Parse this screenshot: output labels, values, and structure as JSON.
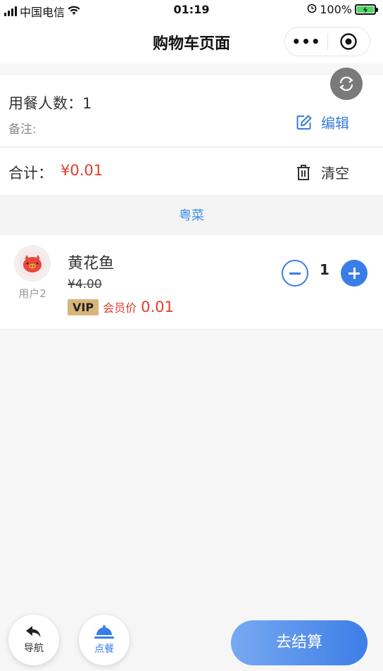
{
  "status_bar": {
    "carrier": "中国电信",
    "time": "01:19",
    "battery": "100%"
  },
  "navbar": {
    "title": "购物车页面",
    "more_label": "•••"
  },
  "order_info": {
    "diners_label": "用餐人数：",
    "diners_count": "1",
    "remark_label": "备注:",
    "edit_label": "编辑"
  },
  "summary": {
    "total_label": "合计：",
    "total_value": "¥0.01",
    "clear_label": "清空"
  },
  "category": {
    "name": "粤菜"
  },
  "cart_items": [
    {
      "user": "用户2",
      "name": "黄花鱼",
      "original_price": "¥4.00",
      "vip_badge": "VIP",
      "vip_label": "会员价",
      "vip_price": "0.01",
      "quantity": "1"
    }
  ],
  "bottom": {
    "nav_label": "导航",
    "order_label": "点餐",
    "checkout_label": "去结算"
  },
  "colors": {
    "accent": "#3a7de8",
    "price_red": "#e53b2c",
    "vip_gold": "#d9b57a",
    "category_blue": "#3a8ee6"
  },
  "icons": {
    "wifi": "wifi-icon",
    "alarm": "alarm-icon",
    "edit": "edit-icon",
    "trash": "trash-icon",
    "refresh": "refresh-icon",
    "back": "reply-arrow-icon",
    "order": "cloche-icon"
  }
}
